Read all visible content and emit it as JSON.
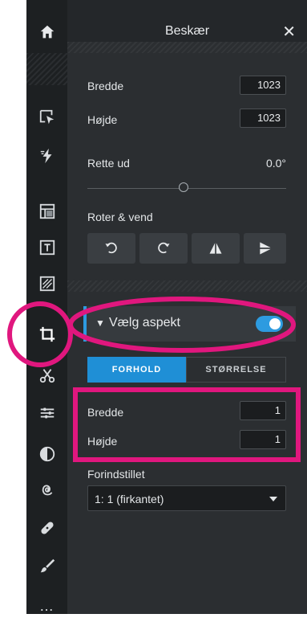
{
  "panel": {
    "title": "Beskær",
    "close_label": "✕",
    "width_label": "Bredde",
    "width_value": "1023",
    "height_label": "Højde",
    "height_value": "1023",
    "straighten_label": "Rette ud",
    "straighten_value": "0.0°",
    "rotate_label": "Roter & vend",
    "aspect": {
      "label": "Vælg aspekt",
      "enabled": true,
      "tabs": [
        "FORHOLD",
        "STØRRELSE"
      ],
      "active_tab": "FORHOLD",
      "ratio_width_label": "Bredde",
      "ratio_width_value": "1",
      "ratio_height_label": "Højde",
      "ratio_height_value": "1",
      "preset_label": "Forindstillet",
      "preset_value": "1: 1 (firkantet)"
    }
  },
  "rail": {
    "icons": [
      "home-icon",
      "cursor-icon",
      "magic-icon",
      "layout-icon",
      "text-icon",
      "texture-icon",
      "crop-icon",
      "cut-icon",
      "adjust-icon",
      "contrast-icon",
      "swirl-icon",
      "bandage-icon",
      "brush-icon",
      "more-icon"
    ],
    "more_label": "…"
  },
  "colors": {
    "accent": "#2d9be0",
    "highlight": "#e0177e"
  }
}
